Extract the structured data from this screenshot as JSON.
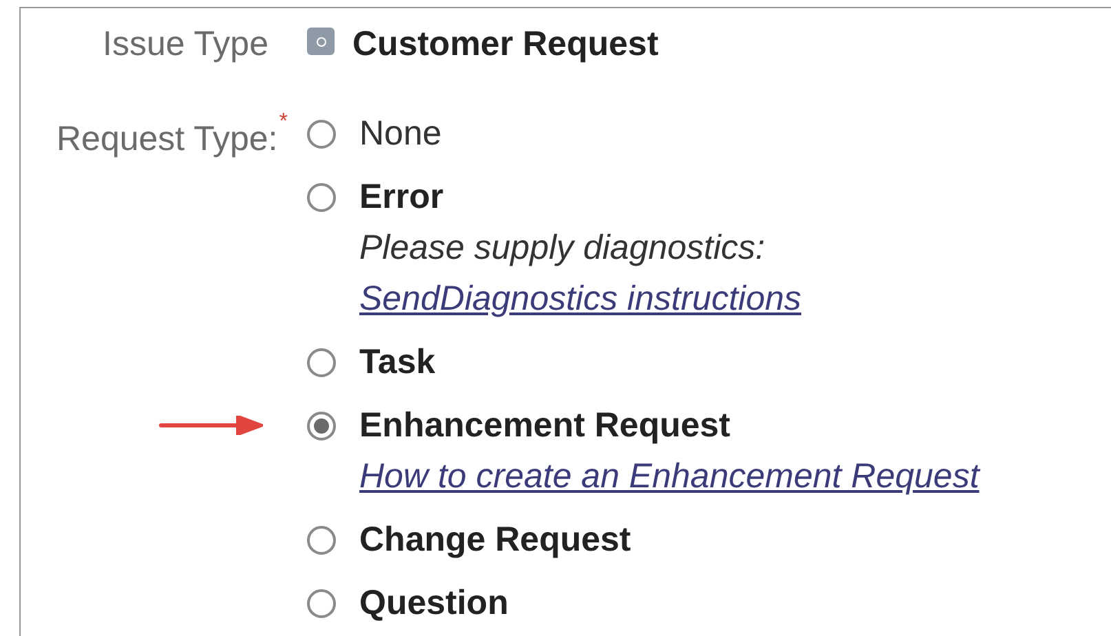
{
  "issue_type": {
    "label": "Issue Type",
    "value": "Customer Request"
  },
  "request_type": {
    "label": "Request Type:",
    "required_mark": "*",
    "options": [
      {
        "label": "None",
        "selected": false,
        "bold": false
      },
      {
        "label": "Error",
        "selected": false,
        "bold": true,
        "notes": [
          {
            "kind": "text",
            "text": "Please supply diagnostics:"
          },
          {
            "kind": "link",
            "text": "SendDiagnostics instructions"
          }
        ]
      },
      {
        "label": "Task",
        "selected": false,
        "bold": true
      },
      {
        "label": "Enhancement Request",
        "selected": true,
        "bold": true,
        "notes": [
          {
            "kind": "link",
            "text": "How to create an Enhancement Request"
          }
        ]
      },
      {
        "label": "Change Request",
        "selected": false,
        "bold": true
      },
      {
        "label": "Question",
        "selected": false,
        "bold": true
      }
    ]
  }
}
